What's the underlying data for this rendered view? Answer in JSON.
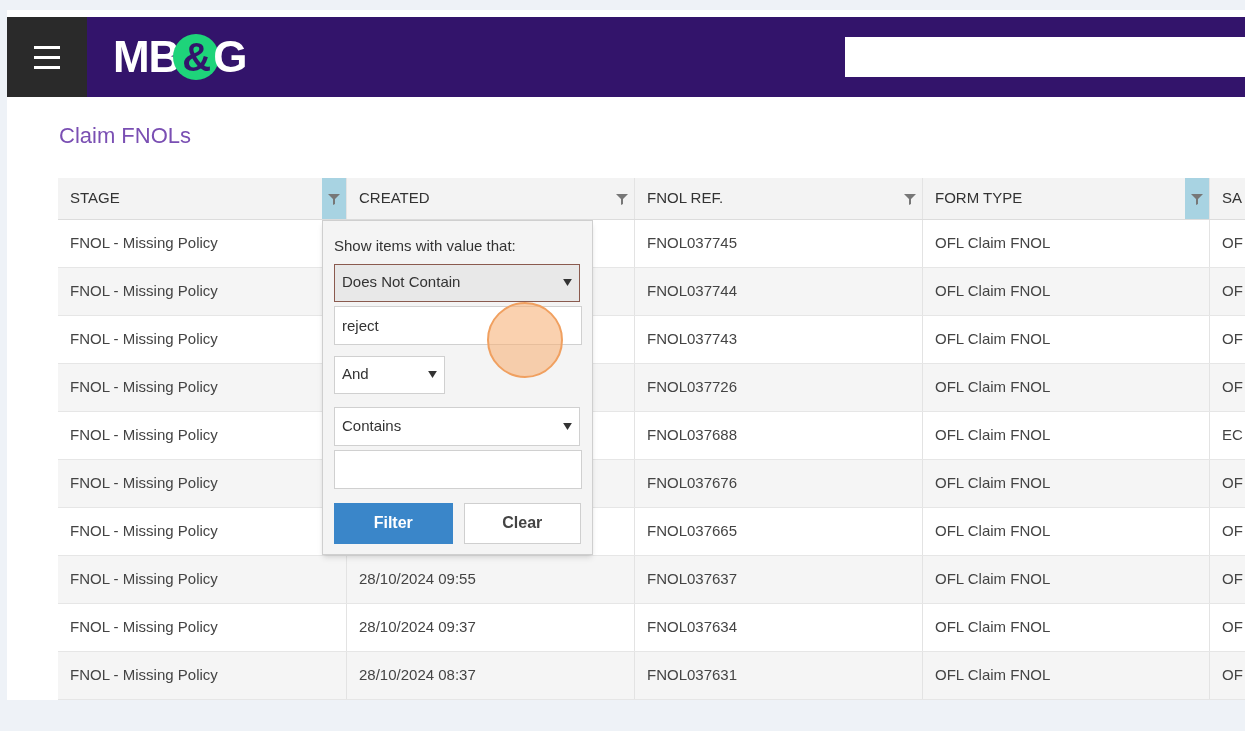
{
  "header": {
    "logo": {
      "before": "MB",
      "amp": "&",
      "after": "G"
    }
  },
  "page_title": "Claim FNOLs",
  "table": {
    "columns": [
      {
        "label": "STAGE",
        "filtered": true
      },
      {
        "label": "CREATED",
        "filtered": false
      },
      {
        "label": "FNOL REF.",
        "filtered": false
      },
      {
        "label": "FORM TYPE",
        "filtered": true
      },
      {
        "label": "SA"
      }
    ],
    "rows": [
      {
        "stage": "FNOL - Missing Policy",
        "fnol_ref": "FNOL037745",
        "form_type": "OFL Claim FNOL",
        "column_5": "OF"
      },
      {
        "stage": "FNOL - Missing Policy",
        "fnol_ref": "FNOL037744",
        "form_type": "OFL Claim FNOL",
        "column_5": "OF"
      },
      {
        "stage": "FNOL - Missing Policy",
        "fnol_ref": "FNOL037743",
        "form_type": "OFL Claim FNOL",
        "column_5": "OF"
      },
      {
        "stage": "FNOL - Missing Policy",
        "fnol_ref": "FNOL037726",
        "form_type": "OFL Claim FNOL",
        "column_5": "OF"
      },
      {
        "stage": "FNOL - Missing Policy",
        "fnol_ref": "FNOL037688",
        "form_type": "OFL Claim FNOL",
        "column_5": "EC"
      },
      {
        "stage": "FNOL - Missing Policy",
        "fnol_ref": "FNOL037676",
        "form_type": "OFL Claim FNOL",
        "column_5": "OF"
      },
      {
        "stage": "FNOL - Missing Policy",
        "fnol_ref": "FNOL037665",
        "form_type": "OFL Claim FNOL",
        "column_5": "OF"
      },
      {
        "stage": "FNOL - Missing Policy",
        "created": "28/10/2024 09:55",
        "fnol_ref": "FNOL037637",
        "form_type": "OFL Claim FNOL",
        "column_5": "OF"
      },
      {
        "stage": "FNOL - Missing Policy",
        "created": "28/10/2024 09:37",
        "fnol_ref": "FNOL037634",
        "form_type": "OFL Claim FNOL",
        "column_5": "OF"
      },
      {
        "stage": "FNOL - Missing Policy",
        "created": "28/10/2024 08:37",
        "fnol_ref": "FNOL037631",
        "form_type": "OFL Claim FNOL",
        "column_5": "OF"
      }
    ]
  },
  "filter_popup": {
    "prompt": "Show items with value that:",
    "operator_1": "Does Not Contain",
    "value_1": "reject",
    "logic": "And",
    "operator_2": "Contains",
    "buttons": [
      "Filter",
      "Clear"
    ]
  }
}
